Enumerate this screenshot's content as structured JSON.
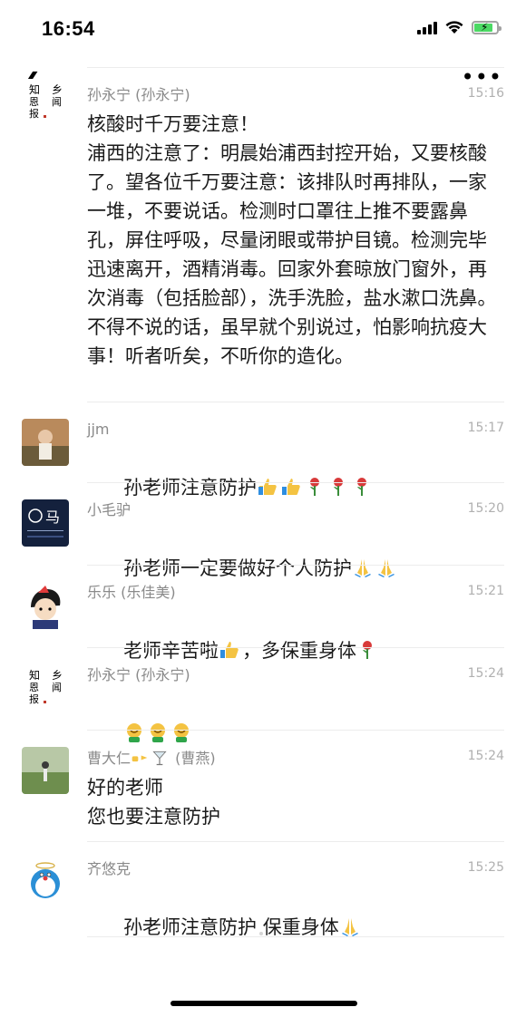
{
  "status_bar": {
    "time": "16:54"
  },
  "messages": [
    {
      "sender": "孙永宁 (孙永宁)",
      "time": "15:16",
      "text": "核酸时千万要注意！\n浦西的注意了：明晨始浦西封控开始，又要核酸了。望各位千万要注意：该排队时再排队，一家一堆，不要说话。检测时口罩往上推不要露鼻孔，屏住呼吸，尽量闭眼或带护目镜。检测完毕迅速离开，酒精消毒。回家外套晾放门窗外，再次消毒（包括脸部），洗手洗脸，盐水漱口洗鼻。不得不说的话，虽早就个别说过，怕影响抗疫大事！听者听矣，不听你的造化。"
    },
    {
      "sender": "jjm",
      "time": "15:17",
      "text": "孙老师注意防护"
    },
    {
      "sender": "小毛驴",
      "time": "15:20",
      "text": "孙老师一定要做好个人防护"
    },
    {
      "sender": "乐乐 (乐佳美)",
      "time": "15:21",
      "text_a": "老师辛苦啦",
      "text_b": "，多保重身体"
    },
    {
      "sender": "孙永宁 (孙永宁)",
      "time": "15:24"
    },
    {
      "sender_a": "曹大仁",
      "sender_b": " (曹燕)",
      "time": "15:24",
      "text": "好的老师\n您也要注意防护"
    },
    {
      "sender": "齐悠克",
      "time": "15:25",
      "text": "孙老师注意防护 保重身体"
    }
  ],
  "icons": {
    "thumbs_up": "thumbs-up-icon",
    "rose": "rose-icon",
    "pray": "pray-icon",
    "smile": "smile-icon"
  },
  "avatar_labels": {
    "donkey": "马"
  },
  "colors": {
    "accent": "#07c160",
    "timestamp": "#b0b0b0",
    "sender": "#8a8a8a"
  }
}
